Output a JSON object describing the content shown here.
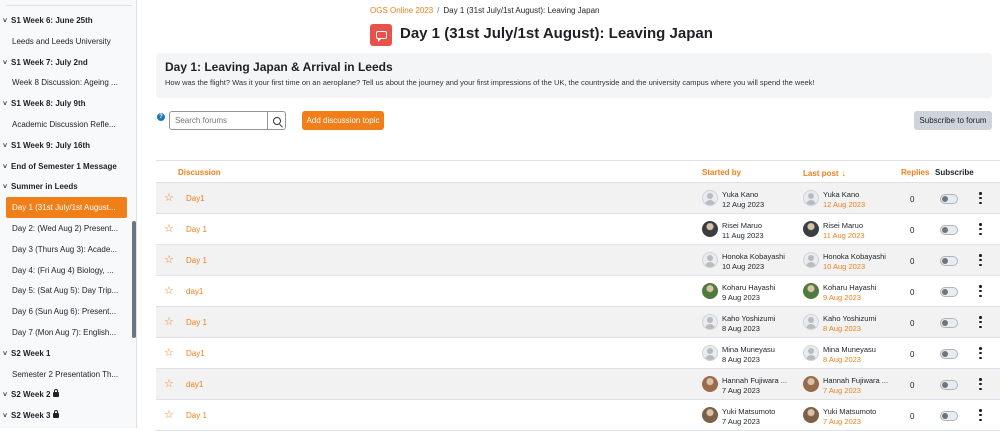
{
  "colors": {
    "accent": "#f07f1a",
    "title_icon": "#e8524a"
  },
  "sidebar": {
    "items": [
      {
        "label": "S1 Week 6: June 25th",
        "type": "section"
      },
      {
        "label": "Leeds and Leeds University",
        "type": "item"
      },
      {
        "label": "S1 Week 7: July 2nd",
        "type": "section"
      },
      {
        "label": "Week 8 Discussion: Ageing ...",
        "type": "item"
      },
      {
        "label": "S1 Week 8: July 9th",
        "type": "section"
      },
      {
        "label": "Academic Discussion Refle...",
        "type": "item"
      },
      {
        "label": "S1 Week 9: July 16th",
        "type": "section"
      },
      {
        "label": "End of Semester 1 Message",
        "type": "section"
      },
      {
        "label": "Summer in Leeds",
        "type": "section"
      },
      {
        "label": "Day 1 (31st July/1st August...",
        "type": "active"
      },
      {
        "label": "Day 2: (Wed Aug 2) Present...",
        "type": "item"
      },
      {
        "label": "Day 3 (Thurs Aug 3): Acade...",
        "type": "item"
      },
      {
        "label": "Day 4: (Fri Aug 4) Biology, ...",
        "type": "item"
      },
      {
        "label": "Day 5: (Sat Aug 5): Day Trip...",
        "type": "item"
      },
      {
        "label": "Day 6 (Sun Aug 6): Present...",
        "type": "item"
      },
      {
        "label": "Day 7 (Mon Aug 7): English...",
        "type": "item"
      },
      {
        "label": "S2 Week 1",
        "type": "section"
      },
      {
        "label": "Semester 2 Presentation Th...",
        "type": "item"
      },
      {
        "label": "S2 Week 2",
        "type": "section",
        "locked": true
      },
      {
        "label": "S2 Week 3",
        "type": "section",
        "locked": true
      }
    ]
  },
  "breadcrumb": {
    "course": "OGS Online 2023",
    "separator": "/",
    "current": "Day 1 (31st July/1st August): Leaving Japan"
  },
  "page_title": "Day 1 (31st July/1st August): Leaving Japan",
  "intro": {
    "title": "Day 1: Leaving Japan & Arrival in Leeds",
    "text": "How was the flight? Was it your first time on an aeroplane? Tell us about the journey and your first impressions of the UK, the countryside and the university campus where you will spend the week!"
  },
  "search": {
    "placeholder": "Search forums",
    "help": "?"
  },
  "add_button": "Add discussion topic",
  "subscribe_forum_button": "Subscribe to forum",
  "table": {
    "headers": {
      "discussion": "Discussion",
      "started_by": "Started by",
      "last_post": "Last post",
      "replies": "Replies",
      "subscribe": "Subscribe"
    },
    "rows": [
      {
        "discussion": "Day1",
        "author": "Yuka Kano",
        "date": "12 Aug 2023",
        "last_author": "Yuka Kano",
        "last_date": "12 Aug 2023",
        "replies": "0",
        "avatar": "default"
      },
      {
        "discussion": "Day 1",
        "author": "Risei Maruo",
        "date": "11 Aug 2023",
        "last_author": "Risei Maruo",
        "last_date": "11 Aug 2023",
        "replies": "0",
        "avatar": "photo-dark"
      },
      {
        "discussion": "Day 1",
        "author": "Honoka Kobayashi",
        "date": "10 Aug 2023",
        "last_author": "Honoka Kobayashi",
        "last_date": "10 Aug 2023",
        "replies": "0",
        "avatar": "default"
      },
      {
        "discussion": "day1",
        "author": "Koharu Hayashi",
        "date": "9 Aug 2023",
        "last_author": "Koharu Hayashi",
        "last_date": "9 Aug 2023",
        "replies": "0",
        "avatar": "photo-green"
      },
      {
        "discussion": "Day 1",
        "author": "Kaho Yoshizumi",
        "date": "8 Aug 2023",
        "last_author": "Kaho Yoshizumi",
        "last_date": "8 Aug 2023",
        "replies": "0",
        "avatar": "default"
      },
      {
        "discussion": "Day1",
        "author": "Mina Muneyasu",
        "date": "8 Aug 2023",
        "last_author": "Mina Muneyasu",
        "last_date": "8 Aug 2023",
        "replies": "0",
        "avatar": "default"
      },
      {
        "discussion": "day1",
        "author": "Hannah Fujiwara ...",
        "date": "7 Aug 2023",
        "last_author": "Hannah Fujiwara ...",
        "last_date": "7 Aug 2023",
        "replies": "0",
        "avatar": "photo-brown"
      },
      {
        "discussion": "Day 1",
        "author": "Yuki Matsumoto",
        "date": "7 Aug 2023",
        "last_author": "Yuki Matsumoto",
        "last_date": "7 Aug 2023",
        "replies": "0",
        "avatar": "photo-tree"
      }
    ]
  }
}
